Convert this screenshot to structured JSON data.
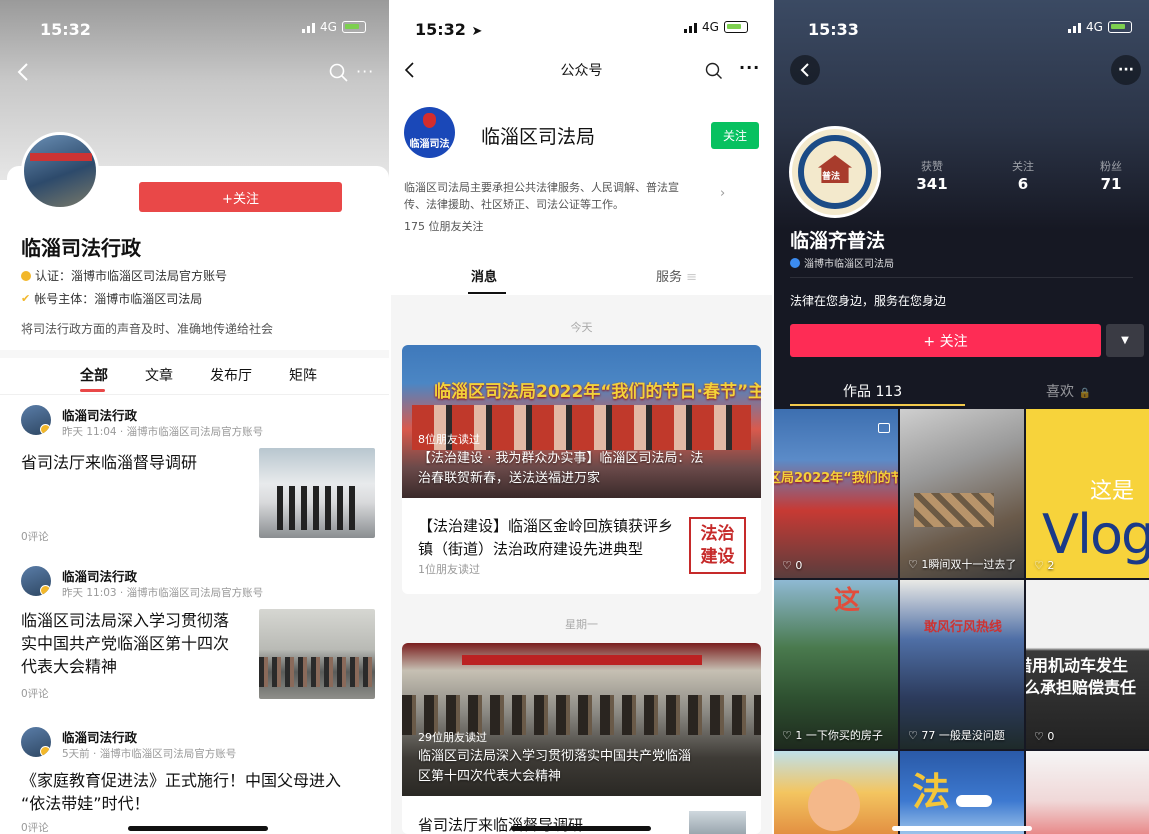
{
  "panel1": {
    "status_time": "15:32",
    "status_network": "4G",
    "follow_label": "+关注",
    "account_name": "临淄司法行政",
    "verify_line": "认证：淄博市临淄区司法局官方账号",
    "owner_line": "帐号主体：淄博市临淄区司法局",
    "bio": "将司法行政方面的声音及时、准确地传递给社会",
    "tabs": [
      "全部",
      "文章",
      "发布厅",
      "矩阵"
    ],
    "posts": [
      {
        "author": "临淄司法行政",
        "meta": "昨天 11:04 · 淄博市临淄区司法局官方账号",
        "title": "省司法厅来临淄督导调研",
        "comments": "0评论"
      },
      {
        "author": "临淄司法行政",
        "meta": "昨天 11:03 · 淄博市临淄区司法局官方账号",
        "title_lines": [
          "临淄区司法局深入学习贯彻落",
          "实中国共产党临淄区第十四次",
          "代表大会精神"
        ],
        "comments": "0评论"
      },
      {
        "author": "临淄司法行政",
        "meta": "5天前 · 淄博市临淄区司法局官方账号",
        "title_lines": [
          "《家庭教育促进法》正式施行！中国父母进入",
          "“依法带娃”时代！"
        ],
        "comments": "0评论"
      }
    ]
  },
  "panel2": {
    "status_time": "15:32",
    "status_network": "4G",
    "nav_title": "公众号",
    "account_name": "临淄区司法局",
    "logo_text": "临淄司法",
    "follow_label": "关注",
    "desc_lines": [
      "临淄区司法局主要承担公共法律服务、人民调解、普法宣",
      "传、法律援助、社区矫正、司法公证等工作。"
    ],
    "friends": "175 位朋友关注",
    "tabs": [
      "消息",
      "服务"
    ],
    "day1": "今天",
    "card1": {
      "banner_text": "临淄区司法局2022年“我们的节日·春节”主题活动",
      "read_count": "8位朋友读过",
      "overlay_lines": [
        "【法治建设 · 我为群众办实事】临淄区司法局：法",
        "治春联贺新春，送法送福进万家"
      ],
      "article_lines": [
        "【法治建设】临淄区金岭回族镇获评乡",
        "镇（街道）法治政府建设先进典型"
      ],
      "article_read": "1位朋友读过",
      "thumb_text": [
        "法治",
        "建设"
      ]
    },
    "day2": "星期一",
    "card2": {
      "read_count": "29位朋友读过",
      "overlay_lines": [
        "临淄区司法局深入学习贯彻落实中国共产党临淄",
        "区第十四次代表大会精神"
      ],
      "article_line": "省司法厅来临淄督导调研"
    }
  },
  "panel3": {
    "status_time": "15:33",
    "status_network": "4G",
    "avatar_text": "普法",
    "stats": [
      {
        "label": "获赞",
        "value": "341"
      },
      {
        "label": "关注",
        "value": "6"
      },
      {
        "label": "粉丝",
        "value": "71"
      }
    ],
    "account_name": "临淄齐普法",
    "verify": "淄博市临淄区司法局",
    "bio": "法律在您身边，服务在您身边",
    "follow_label": "+ 关注",
    "tab_works": "作品 113",
    "tab_likes": "喜欢",
    "tiles": [
      {
        "caption": "0",
        "banner": "区局2022年“我们的节日·春节"
      },
      {
        "caption": "1瞬间双十一过去了"
      },
      {
        "caption": "2",
        "big_text": "Vlog",
        "small_text": "这是"
      },
      {
        "caption": "1 一下你买的房子",
        "banner": "这"
      },
      {
        "caption": "77 一般是没问题",
        "banner": "敢风行风热线"
      },
      {
        "caption": "0",
        "big_text": "借用机动车发生",
        "small_text": "么承担赔偿责任"
      },
      {
        "caption": ""
      },
      {
        "caption": "",
        "banner": "法"
      },
      {
        "caption": ""
      }
    ]
  }
}
